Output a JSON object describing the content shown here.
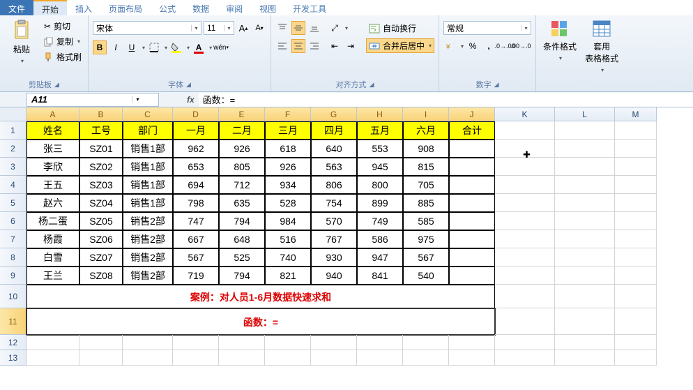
{
  "tabs": {
    "file": "文件",
    "items": [
      "开始",
      "插入",
      "页面布局",
      "公式",
      "数据",
      "审阅",
      "视图",
      "开发工具"
    ],
    "active": 0
  },
  "clipboard": {
    "paste": "粘贴",
    "cut": "剪切",
    "copy": "复制",
    "format_painter": "格式刷",
    "label": "剪贴板"
  },
  "font": {
    "name": "宋体",
    "size": "11",
    "bold": "B",
    "italic": "I",
    "underline": "U",
    "label": "字体"
  },
  "align": {
    "wrap": "自动换行",
    "merge": "合并后居中",
    "label": "对齐方式"
  },
  "number": {
    "format": "常规",
    "label": "数字"
  },
  "styles": {
    "cond": "条件格式",
    "table": "套用\n表格格式"
  },
  "namebox": "A11",
  "formula": "函数：=",
  "cols": [
    "A",
    "B",
    "C",
    "D",
    "E",
    "F",
    "G",
    "H",
    "I",
    "J",
    "K",
    "L",
    "M"
  ],
  "header_row": [
    "姓名",
    "工号",
    "部门",
    "一月",
    "二月",
    "三月",
    "四月",
    "五月",
    "六月",
    "合计"
  ],
  "data_rows": [
    [
      "张三",
      "SZ01",
      "销售1部",
      "962",
      "926",
      "618",
      "640",
      "553",
      "908",
      ""
    ],
    [
      "李欣",
      "SZ02",
      "销售1部",
      "653",
      "805",
      "926",
      "563",
      "945",
      "815",
      ""
    ],
    [
      "王五",
      "SZ03",
      "销售1部",
      "694",
      "712",
      "934",
      "806",
      "800",
      "705",
      ""
    ],
    [
      "赵六",
      "SZ04",
      "销售1部",
      "798",
      "635",
      "528",
      "754",
      "899",
      "885",
      ""
    ],
    [
      "杨二蛋",
      "SZ05",
      "销售2部",
      "747",
      "794",
      "984",
      "570",
      "749",
      "585",
      ""
    ],
    [
      "杨霞",
      "SZ06",
      "销售2部",
      "667",
      "648",
      "516",
      "767",
      "586",
      "975",
      ""
    ],
    [
      "白雪",
      "SZ07",
      "销售2部",
      "567",
      "525",
      "740",
      "930",
      "947",
      "567",
      ""
    ],
    [
      "王兰",
      "SZ08",
      "销售2部",
      "719",
      "794",
      "821",
      "940",
      "841",
      "540",
      ""
    ]
  ],
  "note_row": "案例：对人员1-6月数据快速求和",
  "formula_row": "函数：="
}
